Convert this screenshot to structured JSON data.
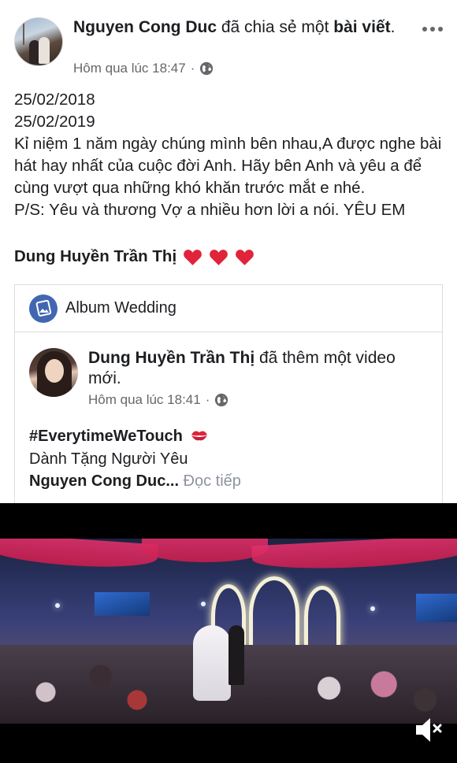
{
  "post": {
    "author": "Nguyen Cong Duc",
    "action_text": " đã chia sẻ một ",
    "action_object": "bài viết",
    "action_end": ".",
    "timestamp": "Hôm qua lúc 18:47",
    "separator": "·",
    "text_lines": [
      "25/02/2018",
      "25/02/2019",
      "Kỉ niệm 1 năm ngày chúng mình bên nhau,A được nghe bài hát hay nhất của cuộc đời Anh. Hãy bên Anh và yêu a để cùng vượt qua những khó khăn trước mắt e nhé.",
      "P/S: Yêu và thương Vợ a nhiều hơn lời a nói. YÊU EM"
    ],
    "tagged_name": "Dung Huyền Trần Thị",
    "icons": [
      "globe-icon",
      "more-icon",
      "heart-icon"
    ]
  },
  "shared": {
    "album_title": "Album Wedding",
    "author": "Dung Huyền Trần Thị",
    "action_text": " đã thêm một video mới.",
    "timestamp": "Hôm qua lúc 18:41",
    "separator": "·",
    "hashtag": "#EverytimeWeTouch",
    "line2": "Dành Tặng Người Yêu",
    "mention": "Nguyen Cong Duc...",
    "see_more": " Đọc tiếp"
  },
  "video": {
    "state": "muted"
  },
  "colors": {
    "text": "#1c1e21",
    "secondary": "#65676b",
    "heart": "#e0243a",
    "album_icon_bg": "#4267b2"
  }
}
